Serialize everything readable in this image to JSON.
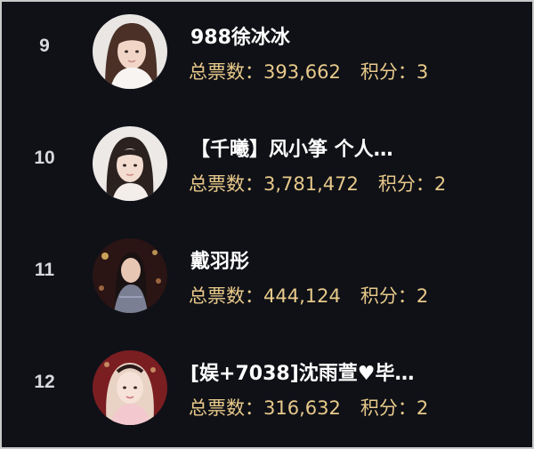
{
  "leaderboard": {
    "votes_label": "总票数：",
    "points_label": "积分：",
    "rows": [
      {
        "rank": "9",
        "name": "988徐冰冰",
        "votes": "393,662",
        "points": "3",
        "avatar": "streamer-avatar"
      },
      {
        "rank": "10",
        "name": "【千曦】风小筝 个人…",
        "votes": "3,781,472",
        "points": "2",
        "avatar": "streamer-avatar"
      },
      {
        "rank": "11",
        "name": "戴羽彤",
        "votes": "444,124",
        "points": "2",
        "avatar": "streamer-avatar"
      },
      {
        "rank": "12",
        "name": "[娱+7038]沈雨萱♥毕…",
        "votes": "316,632",
        "points": "2",
        "avatar": "streamer-avatar"
      }
    ]
  },
  "colors": {
    "background": "#0f1117",
    "rank_text": "#d7d9de",
    "name_text": "#ffffff",
    "stats_text": "#e8c98a"
  }
}
